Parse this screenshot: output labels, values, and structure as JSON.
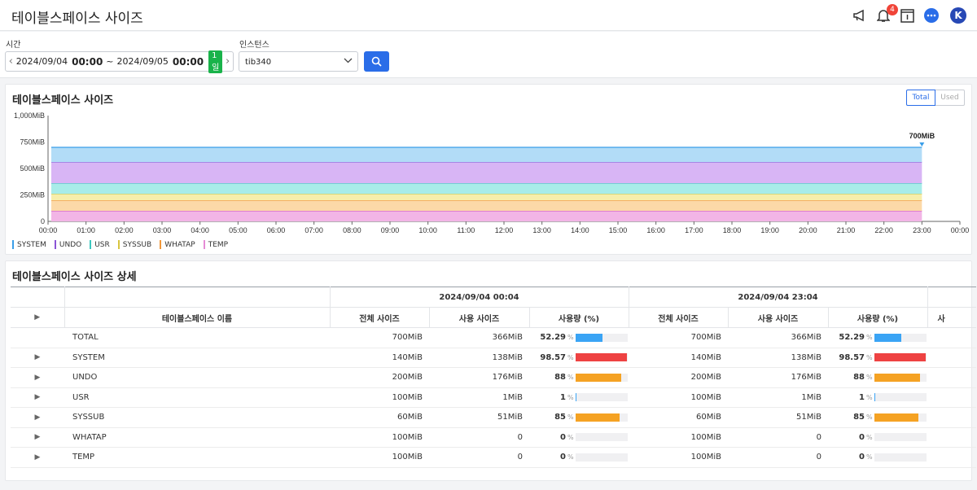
{
  "header": {
    "title": "테이블스페이스 사이즈",
    "notification_count": "4",
    "avatar_letter": "K"
  },
  "filters": {
    "time_label": "시간",
    "time_start_date": "2024/09/04",
    "time_start_time": "00:00",
    "time_sep": "~",
    "time_end_date": "2024/09/05",
    "time_end_time": "00:00",
    "range_badge": "1일",
    "instance_label": "인스턴스",
    "instance_value": "tib340"
  },
  "chart_panel": {
    "title": "테이블스페이스 사이즈",
    "toggle_total": "Total",
    "toggle_used": "Used",
    "tooltip": "700MiB"
  },
  "chart_data": {
    "type": "area",
    "stacked": true,
    "y_ticks": [
      "1,000MiB",
      "750MiB",
      "500MiB",
      "250MiB",
      "0"
    ],
    "ylim": [
      0,
      1000
    ],
    "x_ticks": [
      "00:00",
      "01:00",
      "02:00",
      "03:00",
      "04:00",
      "05:00",
      "06:00",
      "07:00",
      "08:00",
      "09:00",
      "10:00",
      "11:00",
      "12:00",
      "13:00",
      "14:00",
      "15:00",
      "16:00",
      "17:00",
      "18:00",
      "19:00",
      "20:00",
      "21:00",
      "22:00",
      "23:00",
      "00:00"
    ],
    "x_range_hours": [
      0,
      24
    ],
    "series_end_hour": 23,
    "series": [
      {
        "name": "TEMP",
        "value": 100,
        "color": "#f2b5e6"
      },
      {
        "name": "WHATAP",
        "value": 100,
        "color": "#fcd9a8"
      },
      {
        "name": "SYSSUB",
        "value": 60,
        "color": "#f7eeab"
      },
      {
        "name": "USR",
        "value": 100,
        "color": "#a8ece9"
      },
      {
        "name": "UNDO",
        "value": 200,
        "color": "#d8b5f5"
      },
      {
        "name": "SYSTEM",
        "value": 140,
        "color": "#b2dcf7"
      }
    ],
    "line_colors": {
      "TEMP": "#d35fc2",
      "WHATAP": "#f0973a",
      "SYSSUB": "#d8c540",
      "USR": "#3cc7bf",
      "UNDO": "#8b54d6",
      "SYSTEM": "#3a9ee8"
    },
    "legend": [
      {
        "name": "SYSTEM",
        "color": "#3a9ee8"
      },
      {
        "name": "UNDO",
        "color": "#8b54d6"
      },
      {
        "name": "USR",
        "color": "#3cc7bf"
      },
      {
        "name": "SYSSUB",
        "color": "#d8c540"
      },
      {
        "name": "WHATAP",
        "color": "#f0973a"
      },
      {
        "name": "TEMP",
        "color": "#e58bd6"
      }
    ],
    "legend_position": "bottom-left"
  },
  "table_panel": {
    "title": "테이블스페이스 사이즈 상세",
    "group_headers": [
      "2024/09/04 00:04",
      "2024/09/04 23:04"
    ],
    "name_header": "테이블스페이스 이름",
    "col_headers": [
      "전체 사이즈",
      "사용 사이즈",
      "사용량 (%)",
      "전체 사이즈",
      "사용 사이즈",
      "사용량 (%)",
      "사"
    ],
    "pct_unit": "%",
    "rows": [
      {
        "name": "TOTAL",
        "expand": false,
        "a_total": "700MiB",
        "a_used": "366MiB",
        "a_pct": "52.29",
        "a_frac": 0.5229,
        "a_color": "#3aa4f5",
        "b_total": "700MiB",
        "b_used": "366MiB",
        "b_pct": "52.29",
        "b_frac": 0.5229,
        "b_color": "#3aa4f5"
      },
      {
        "name": "SYSTEM",
        "expand": true,
        "a_total": "140MiB",
        "a_used": "138MiB",
        "a_pct": "98.57",
        "a_frac": 0.9857,
        "a_color": "#ee4242",
        "b_total": "140MiB",
        "b_used": "138MiB",
        "b_pct": "98.57",
        "b_frac": 0.9857,
        "b_color": "#ee4242"
      },
      {
        "name": "UNDO",
        "expand": true,
        "a_total": "200MiB",
        "a_used": "176MiB",
        "a_pct": "88",
        "a_frac": 0.88,
        "a_color": "#f5a223",
        "b_total": "200MiB",
        "b_used": "176MiB",
        "b_pct": "88",
        "b_frac": 0.88,
        "b_color": "#f5a223"
      },
      {
        "name": "USR",
        "expand": true,
        "a_total": "100MiB",
        "a_used": "1MiB",
        "a_pct": "1",
        "a_frac": 0.01,
        "a_color": "#3aa4f5",
        "b_total": "100MiB",
        "b_used": "1MiB",
        "b_pct": "1",
        "b_frac": 0.01,
        "b_color": "#3aa4f5"
      },
      {
        "name": "SYSSUB",
        "expand": true,
        "a_total": "60MiB",
        "a_used": "51MiB",
        "a_pct": "85",
        "a_frac": 0.85,
        "a_color": "#f5a223",
        "b_total": "60MiB",
        "b_used": "51MiB",
        "b_pct": "85",
        "b_frac": 0.85,
        "b_color": "#f5a223"
      },
      {
        "name": "WHATAP",
        "expand": true,
        "a_total": "100MiB",
        "a_used": "0",
        "a_pct": "0",
        "a_frac": 0,
        "a_color": "#3aa4f5",
        "b_total": "100MiB",
        "b_used": "0",
        "b_pct": "0",
        "b_frac": 0,
        "b_color": "#3aa4f5"
      },
      {
        "name": "TEMP",
        "expand": true,
        "a_total": "100MiB",
        "a_used": "0",
        "a_pct": "0",
        "a_frac": 0,
        "a_color": "#3aa4f5",
        "b_total": "100MiB",
        "b_used": "0",
        "b_pct": "0",
        "b_frac": 0,
        "b_color": "#3aa4f5"
      }
    ]
  }
}
